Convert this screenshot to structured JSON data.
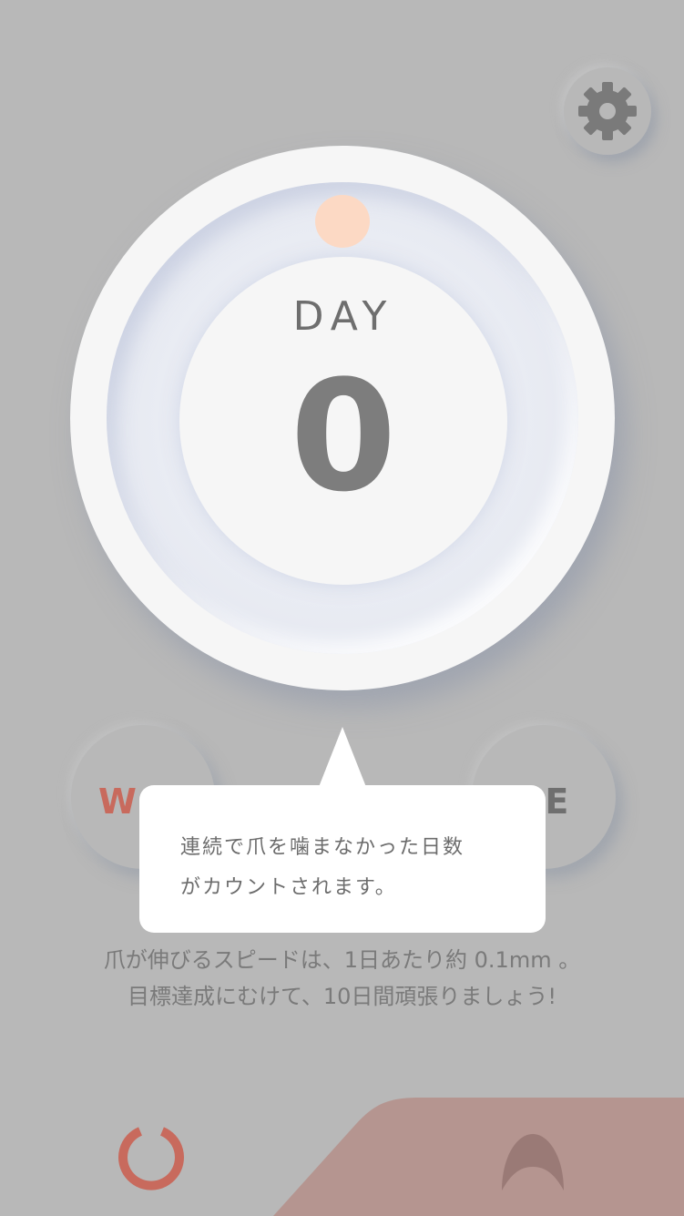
{
  "header": {
    "settings_icon": "gear-icon"
  },
  "counter": {
    "label": "DAY",
    "value": "0"
  },
  "buttons": {
    "left_label": "W",
    "right_label": "SE"
  },
  "tooltip": {
    "line1": "連続で爪を噛まなかった日数",
    "line2": "がカウントされます。"
  },
  "info": {
    "line1": "爪が伸びるスピードは、1日あたり約 0.1mm 。",
    "line2": "目標達成にむけて、10日間頑張りましょう!"
  },
  "bottom_bar": {
    "left_icon": "reload-icon",
    "right_icon": "nail-icon"
  },
  "colors": {
    "background": "#b8b8b8",
    "accent_red": "#c86a5d",
    "indicator_dot": "#fcd9c4",
    "bottom_bar": "#b59590"
  }
}
